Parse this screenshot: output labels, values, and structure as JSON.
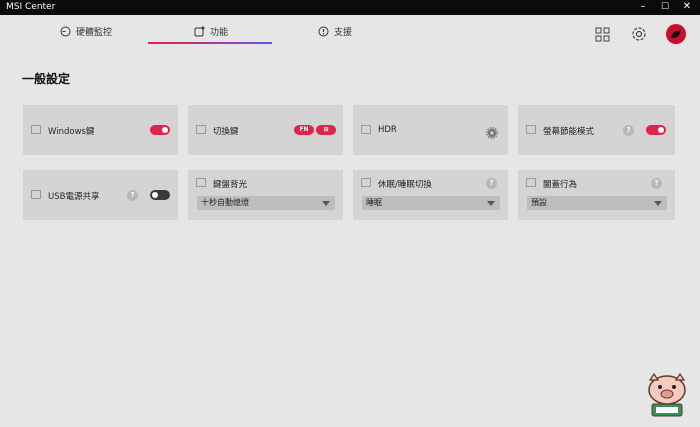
{
  "window": {
    "title": "MSI Center",
    "controls": {
      "minimize": "–",
      "maximize": "☐",
      "close": "✕"
    }
  },
  "nav": {
    "tabs": [
      {
        "label": "硬體監控",
        "icon": "gauge-icon"
      },
      {
        "label": "功能",
        "icon": "feature-icon",
        "active": true
      },
      {
        "label": "支援",
        "icon": "info-icon"
      }
    ]
  },
  "top_icons": [
    "grid-icon",
    "gear-icon",
    "avatar-icon"
  ],
  "page": {
    "title": "一般設定"
  },
  "cards": {
    "windows_key": {
      "label": "Windows鍵",
      "toggle": "on"
    },
    "switch_key": {
      "label": "切換鍵",
      "pill_fn": "FN",
      "pill_win": "⊞"
    },
    "hdr": {
      "label": "HDR"
    },
    "screen_save": {
      "label": "螢幕節能模式",
      "help": "?",
      "toggle": "on"
    },
    "usb_power": {
      "label": "USB電源共享",
      "help": "?",
      "toggle": "off"
    },
    "kb_backlight": {
      "label": "鍵盤背光",
      "selected": "十秒自動熄燈"
    },
    "sleep_switch": {
      "label": "休眠/睡眠切換",
      "help": "?",
      "selected": "睡眠"
    },
    "lid_action": {
      "label": "闔蓋行為",
      "help": "?",
      "selected": "預設"
    }
  },
  "colors": {
    "accent": "#e0254a",
    "accent2": "#6a54e0",
    "card": "#d4d4d4",
    "bg": "#e6e6e6"
  }
}
